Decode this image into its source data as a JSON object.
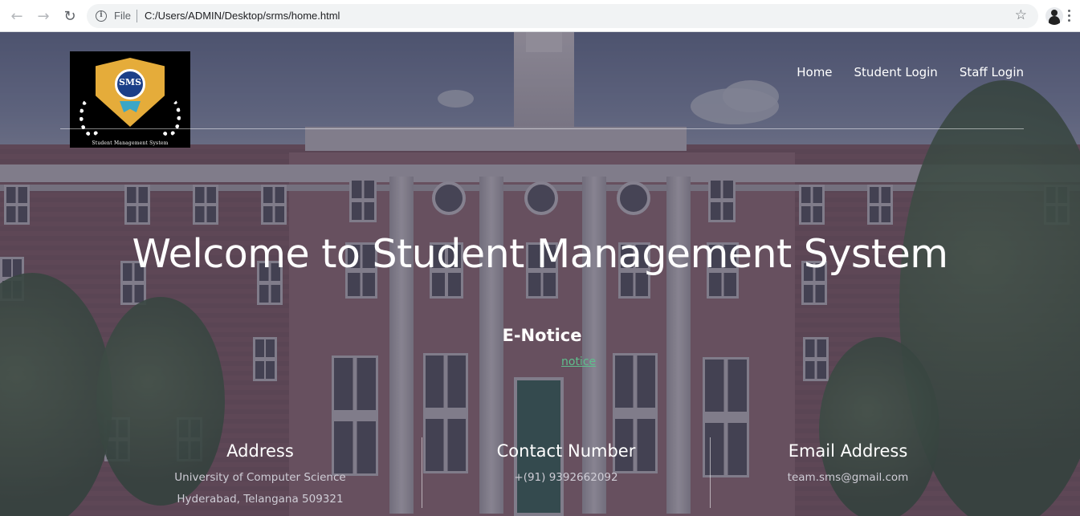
{
  "browser": {
    "scheme_label": "File",
    "url": "C:/Users/ADMIN/Desktop/srms/home.html"
  },
  "icons": {
    "back": "arrow-left-icon",
    "forward": "arrow-right-icon",
    "reload": "reload-icon",
    "info": "info-icon",
    "bookmark": "star-icon",
    "profile": "profile-avatar-icon",
    "menu": "kebab-menu-icon"
  },
  "logo": {
    "badge_text": "SMS",
    "caption": "Student Management System"
  },
  "nav": {
    "items": [
      {
        "label": "Home"
      },
      {
        "label": "Student Login"
      },
      {
        "label": "Staff Login"
      }
    ]
  },
  "hero": {
    "title": "Welcome to Student Management System"
  },
  "notice": {
    "title": "E-Notice",
    "link_label": "notice"
  },
  "info": {
    "address": {
      "heading": "Address",
      "line1": "University of Computer Science",
      "line2": "Hyderabad, Telangana 509321"
    },
    "contact": {
      "heading": "Contact Number",
      "value": "+(91) 9392662092"
    },
    "email": {
      "heading": "Email Address",
      "value": "team.sms@gmail.com"
    }
  },
  "colors": {
    "link": "#5fbf8d",
    "text_primary": "#ffffff",
    "overlay": "#3c374b"
  }
}
